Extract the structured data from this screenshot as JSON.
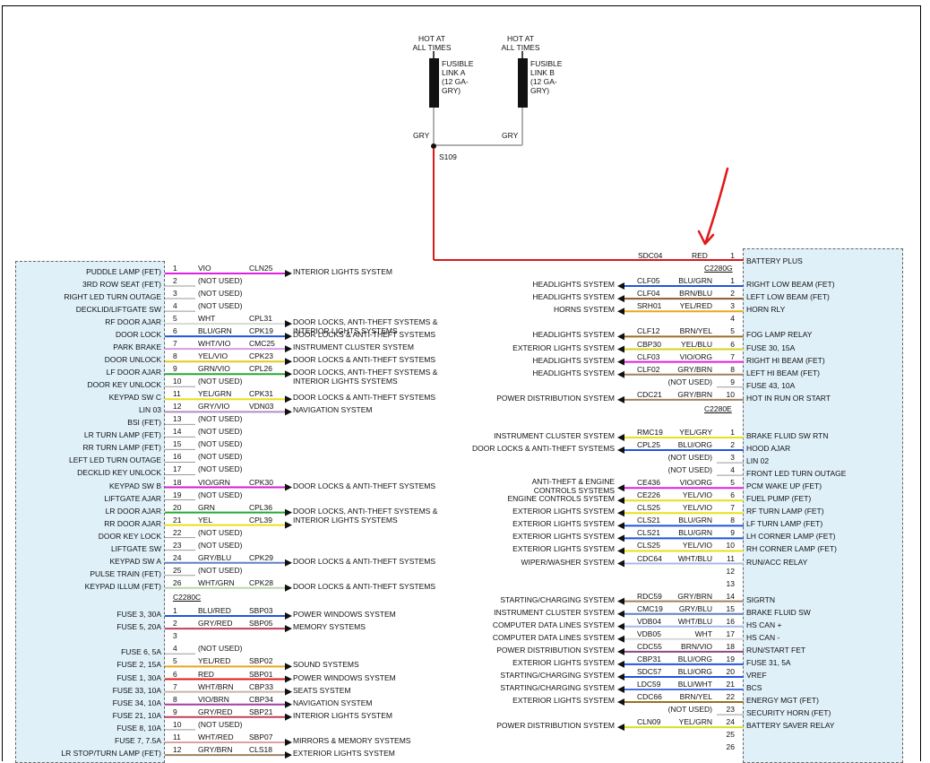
{
  "top": {
    "hot_a": "HOT AT\nALL TIMES",
    "hot_b": "HOT AT\nALL TIMES",
    "fuse_a": "FUSIBLE\nLINK A\n(12 GA-\nGRY)",
    "fuse_b": "FUSIBLE\nLINK B\n(12 GA-\nGRY)",
    "gry_a": "GRY",
    "gry_b": "GRY",
    "splice": "S109",
    "sdc04": "SDC04",
    "red": "RED"
  },
  "colors": {
    "red_wire": "#d91a1a",
    "box_fill": "#dff0f9",
    "gray_wire": "#b0b0b0"
  },
  "left": {
    "connector_c": "C2280C",
    "rows": [
      {
        "n": "1",
        "label": "PUDDLE LAMP (FET)",
        "wire": "VIO",
        "circ": "CLN25",
        "dest": "INTERIOR LIGHTS SYSTEM",
        "color": "#e020e0"
      },
      {
        "n": "2",
        "label": "3RD ROW SEAT (FET)",
        "wire": "(NOT USED)"
      },
      {
        "n": "3",
        "label": "RIGHT LED TURN OUTAGE",
        "wire": "(NOT USED)"
      },
      {
        "n": "4",
        "label": "DECKLID/LIFTGATE SW",
        "wire": "(NOT USED)"
      },
      {
        "n": "5",
        "label": "RF DOOR AJAR",
        "wire": "WHT",
        "circ": "CPL31",
        "dest": "DOOR LOCKS, ANTI-THEFT SYSTEMS &\nINTERIOR LIGHTS SYSTEMS",
        "color": "#d8d8d8"
      },
      {
        "n": "6",
        "label": "DOOR LOCK",
        "wire": "BLU/GRN",
        "circ": "CPK19",
        "dest": "DOOR LOCKS & ANTI-THEFT SYSTEMS",
        "color": "#2255dd"
      },
      {
        "n": "7",
        "label": "PARK BRAKE",
        "wire": "WHT/VIO",
        "circ": "CMC25",
        "dest": "INSTRUMENT CLUSTER SYSTEM",
        "color": "#d49ee6"
      },
      {
        "n": "8",
        "label": "DOOR UNLOCK",
        "wire": "YEL/VIO",
        "circ": "CPK23",
        "dest": "DOOR LOCKS & ANTI-THEFT SYSTEMS",
        "color": "#e8c81a"
      },
      {
        "n": "9",
        "label": "LF DOOR AJAR",
        "wire": "GRN/VIO",
        "circ": "CPL26",
        "dest": "DOOR LOCKS, ANTI-THEFT SYSTEMS &\nINTERIOR LIGHTS SYSTEMS",
        "color": "#22aa33"
      },
      {
        "n": "10",
        "label": "DOOR KEY UNLOCK",
        "wire": "(NOT USED)"
      },
      {
        "n": "11",
        "label": "KEYPAD SW C",
        "wire": "YEL/GRN",
        "circ": "CPK31",
        "dest": "DOOR LOCKS & ANTI-THEFT SYSTEMS",
        "color": "#e8e01a"
      },
      {
        "n": "12",
        "label": "LIN 03",
        "wire": "GRY/VIO",
        "circ": "VDN03",
        "dest": "NAVIGATION SYSTEM",
        "color": "#b090c0"
      },
      {
        "n": "13",
        "label": "BSI (FET)",
        "wire": "(NOT USED)"
      },
      {
        "n": "14",
        "label": "LR TURN LAMP (FET)",
        "wire": "(NOT USED)"
      },
      {
        "n": "15",
        "label": "RR TURN LAMP (FET)",
        "wire": "(NOT USED)"
      },
      {
        "n": "16",
        "label": "LEFT LED TURN OUTAGE",
        "wire": "(NOT USED)"
      },
      {
        "n": "17",
        "label": "DECKLID KEY UNLOCK",
        "wire": "(NOT USED)"
      },
      {
        "n": "18",
        "label": "KEYPAD SW B",
        "wire": "VIO/GRN",
        "circ": "CPK30",
        "dest": "DOOR LOCKS & ANTI-THEFT SYSTEMS",
        "color": "#d020d0"
      },
      {
        "n": "19",
        "label": "LIFTGATE AJAR",
        "wire": "(NOT USED)"
      },
      {
        "n": "20",
        "label": "LR DOOR AJAR",
        "wire": "GRN",
        "circ": "CPL36",
        "dest": "DOOR LOCKS, ANTI-THEFT SYSTEMS &\nINTERIOR LIGHTS SYSTEMS",
        "color": "#22aa33"
      },
      {
        "n": "21",
        "label": "RR DOOR AJAR",
        "wire": "YEL",
        "circ": "CPL39",
        "dest": "",
        "color": "#e8e01a"
      },
      {
        "n": "22",
        "label": "DOOR KEY LOCK",
        "wire": "(NOT USED)"
      },
      {
        "n": "23",
        "label": "LIFTGATE SW",
        "wire": "(NOT USED)"
      },
      {
        "n": "24",
        "label": "KEYPAD SW A",
        "wire": "GRY/BLU",
        "circ": "CPK29",
        "dest": "DOOR LOCKS & ANTI-THEFT SYSTEMS",
        "color": "#6080c0"
      },
      {
        "n": "25",
        "label": "PULSE TRAIN (FET)",
        "wire": "(NOT USED)"
      },
      {
        "n": "26",
        "label": "KEYPAD ILLUM (FET)",
        "wire": "WHT/GRN",
        "circ": "CPK28",
        "dest": "DOOR LOCKS & ANTI-THEFT SYSTEMS",
        "color": "#b8d8b0"
      }
    ],
    "rows_c": [
      {
        "n": "1",
        "label": "FUSE 3, 30A",
        "wire": "BLU/RED",
        "circ": "SBP03",
        "dest": "POWER WINDOWS SYSTEM",
        "color": "#2255dd"
      },
      {
        "n": "2",
        "label": "FUSE 5, 20A",
        "wire": "GRY/RED",
        "circ": "SBP05",
        "dest": "MEMORY SYSTEMS",
        "color": "#c04060"
      },
      {
        "n": "3",
        "label": "",
        "wire": ""
      },
      {
        "n": "4",
        "label": "FUSE 6, 5A",
        "wire": "(NOT USED)"
      },
      {
        "n": "5",
        "label": "FUSE 2, 15A",
        "wire": "YEL/RED",
        "circ": "SBP02",
        "dest": "SOUND SYSTEMS",
        "color": "#e8a81a"
      },
      {
        "n": "6",
        "label": "FUSE 1, 30A",
        "wire": "RED",
        "circ": "SBP01",
        "dest": "POWER WINDOWS SYSTEM",
        "color": "#dd1a1a"
      },
      {
        "n": "7",
        "label": "FUSE 33, 10A",
        "wire": "WHT/BRN",
        "circ": "CBP33",
        "dest": "SEATS SYSTEM",
        "color": "#c8b8a8"
      },
      {
        "n": "8",
        "label": "FUSE 34, 10A",
        "wire": "VIO/BRN",
        "circ": "CBP34",
        "dest": "NAVIGATION SYSTEM",
        "color": "#a040a0"
      },
      {
        "n": "9",
        "label": "FUSE 21, 10A",
        "wire": "GRY/RED",
        "circ": "SBP21",
        "dest": "INTERIOR LIGHTS SYSTEM",
        "color": "#c04060"
      },
      {
        "n": "10",
        "label": "FUSE 8, 10A",
        "wire": "(NOT USED)"
      },
      {
        "n": "11",
        "label": "FUSE 7, 7.5A",
        "wire": "WHT/RED",
        "circ": "SBP07",
        "dest": "MIRRORS & MEMORY SYSTEMS",
        "color": "#e0a0a0"
      },
      {
        "n": "12",
        "label": "LR STOP/TURN LAMP (FET)",
        "wire": "GRY/BRN",
        "circ": "CLS18",
        "dest": "EXTERIOR LIGHTS SYSTEM",
        "color": "#a08060"
      }
    ]
  },
  "right": {
    "connector_g": "C2280G",
    "connector_e": "C2280E",
    "rows_g": [
      {
        "n": "1",
        "label": "BATTERY PLUS",
        "wire": "",
        "circ": "",
        "src": "",
        "color": ""
      },
      {
        "n": "1",
        "label": "RIGHT LOW BEAM (FET)",
        "wire": "BLU/GRN",
        "circ": "CLF05",
        "src": "HEADLIGHTS SYSTEM",
        "color": "#2255dd"
      },
      {
        "n": "2",
        "label": "LEFT LOW BEAM (FET)",
        "wire": "BRN/BLU",
        "circ": "CLF04",
        "src": "HEADLIGHTS SYSTEM",
        "color": "#8a5a30"
      },
      {
        "n": "3",
        "label": "HORN RLY",
        "wire": "YEL/RED",
        "circ": "SRH01",
        "src": "HORNS SYSTEM",
        "color": "#e8a81a"
      },
      {
        "n": "4",
        "label": "",
        "wire": ""
      },
      {
        "n": "5",
        "label": "FOG LAMP RELAY",
        "wire": "BRN/YEL",
        "circ": "CLF12",
        "src": "HEADLIGHTS SYSTEM",
        "color": "#9a7020"
      },
      {
        "n": "6",
        "label": "FUSE 30, 15A",
        "wire": "YEL/BLU",
        "circ": "CBP30",
        "src": "EXTERIOR LIGHTS SYSTEM",
        "color": "#d8d020"
      },
      {
        "n": "7",
        "label": "RIGHT HI BEAM (FET)",
        "wire": "VIO/ORG",
        "circ": "CLF03",
        "src": "HEADLIGHTS SYSTEM",
        "color": "#e020e0"
      },
      {
        "n": "8",
        "label": "LEFT HI BEAM (FET)",
        "wire": "GRY/BRN",
        "circ": "CLF02",
        "src": "HEADLIGHTS SYSTEM",
        "color": "#a08060"
      },
      {
        "n": "9",
        "label": "FUSE 43, 10A",
        "wire": "(NOT USED)"
      },
      {
        "n": "10",
        "label": "HOT IN RUN OR START",
        "wire": "GRY/BRN",
        "circ": "CDC21",
        "src": "POWER DISTRIBUTION SYSTEM",
        "color": "#a08060"
      }
    ],
    "rows_e": [
      {
        "n": "1",
        "label": "BRAKE FLUID SW RTN",
        "wire": "YEL/GRY",
        "circ": "RMC19",
        "src": "INSTRUMENT CLUSTER SYSTEM",
        "color": "#e8e01a"
      },
      {
        "n": "2",
        "label": "HOOD AJAR",
        "wire": "BLU/ORG",
        "circ": "CPL25",
        "src": "DOOR LOCKS & ANTI-THEFT SYSTEMS",
        "color": "#2255dd"
      },
      {
        "n": "3",
        "label": "LIN 02",
        "wire": "(NOT USED)"
      },
      {
        "n": "4",
        "label": "FRONT LED TURN OUTAGE",
        "wire": "(NOT USED)"
      },
      {
        "n": "5",
        "label": "PCM WAKE UP (FET)",
        "wire": "VIO/ORG",
        "circ": "CE436",
        "src": "ANTI-THEFT & ENGINE\nCONTROLS SYSTEMS",
        "color": "#e020e0"
      },
      {
        "n": "6",
        "label": "FUEL PUMP (FET)",
        "wire": "YEL/VIO",
        "circ": "CE226",
        "src": "ENGINE CONTROLS SYSTEM",
        "color": "#e8e01a"
      },
      {
        "n": "7",
        "label": "RF TURN LAMP (FET)",
        "wire": "YEL/VIO",
        "circ": "CLS25",
        "src": "EXTERIOR LIGHTS SYSTEM",
        "color": "#e8e01a"
      },
      {
        "n": "8",
        "label": "LF TURN LAMP (FET)",
        "wire": "BLU/GRN",
        "circ": "CLS21",
        "src": "EXTERIOR LIGHTS SYSTEM",
        "color": "#2255dd"
      },
      {
        "n": "9",
        "label": "LH CORNER LAMP (FET)",
        "wire": "BLU/GRN",
        "circ": "CLS21",
        "src": "EXTERIOR LIGHTS SYSTEM",
        "color": "#2255dd"
      },
      {
        "n": "10",
        "label": "RH CORNER LAMP (FET)",
        "wire": "YEL/VIO",
        "circ": "CLS25",
        "src": "EXTERIOR LIGHTS SYSTEM",
        "color": "#e8e01a"
      },
      {
        "n": "11",
        "label": "RUN/ACC RELAY",
        "wire": "WHT/BLU",
        "circ": "CDC64",
        "src": "WIPER/WASHER SYSTEM",
        "color": "#a8b8e8"
      },
      {
        "n": "12",
        "label": "",
        "wire": ""
      },
      {
        "n": "13",
        "label": "",
        "wire": ""
      },
      {
        "n": "14",
        "label": "SIGRTN",
        "wire": "GRY/BRN",
        "circ": "RDC59",
        "src": "STARTING/CHARGING SYSTEM",
        "color": "#a08060"
      },
      {
        "n": "15",
        "label": "BRAKE FLUID SW",
        "wire": "GRY/BLU",
        "circ": "CMC19",
        "src": "INSTRUMENT CLUSTER SYSTEM",
        "color": "#6080c0"
      },
      {
        "n": "16",
        "label": "HS CAN +",
        "wire": "WHT/BLU",
        "circ": "VDB04",
        "src": "COMPUTER DATA LINES SYSTEM",
        "color": "#a8b8e8"
      },
      {
        "n": "17",
        "label": "HS CAN -",
        "wire": "WHT",
        "circ": "VDB05",
        "src": "COMPUTER DATA LINES SYSTEM",
        "color": "#d8d8d8"
      },
      {
        "n": "18",
        "label": "RUN/START FET",
        "wire": "BRN/VIO",
        "circ": "CDC55",
        "src": "POWER DISTRIBUTION SYSTEM",
        "color": "#8a4a80"
      },
      {
        "n": "19",
        "label": "FUSE 31, 5A",
        "wire": "BLU/ORG",
        "circ": "CBP31",
        "src": "EXTERIOR LIGHTS SYSTEM",
        "color": "#2255dd"
      },
      {
        "n": "20",
        "label": "VREF",
        "wire": "BLU/ORG",
        "circ": "SDC57",
        "src": "STARTING/CHARGING SYSTEM",
        "color": "#2255dd"
      },
      {
        "n": "21",
        "label": "BCS",
        "wire": "BLU/WHT",
        "circ": "LDC59",
        "src": "STARTING/CHARGING SYSTEM",
        "color": "#4a6ee0"
      },
      {
        "n": "22",
        "label": "ENERGY MGT (FET)",
        "wire": "BRN/YEL",
        "circ": "CDC66",
        "src": "EXTERIOR LIGHTS SYSTEM",
        "color": "#9a7020"
      },
      {
        "n": "23",
        "label": "SECURITY HORN (FET)",
        "wire": "(NOT USED)"
      },
      {
        "n": "24",
        "label": "BATTERY SAVER RELAY",
        "wire": "YEL/GRN",
        "circ": "CLN09",
        "src": "POWER DISTRIBUTION SYSTEM",
        "color": "#d8e020"
      },
      {
        "n": "25",
        "label": "",
        "wire": ""
      },
      {
        "n": "26",
        "label": "",
        "wire": ""
      }
    ]
  }
}
